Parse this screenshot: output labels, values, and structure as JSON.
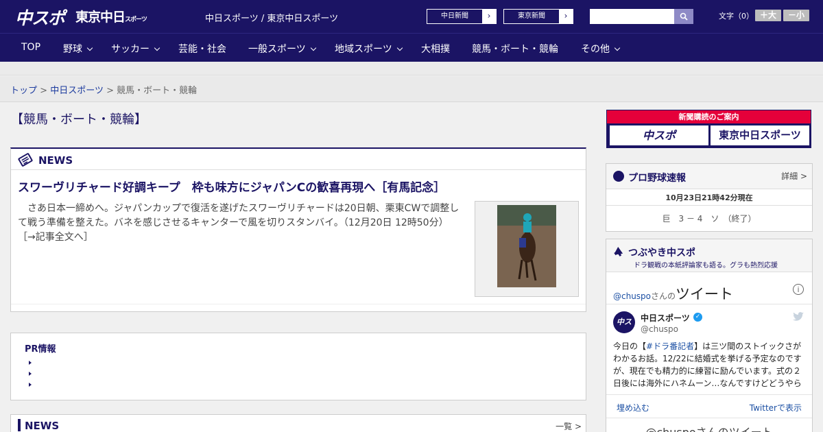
{
  "header": {
    "logo_chuspo": "中スポ",
    "logo_tokyo": "東京中日",
    "logo_tokyo_sub": "スポーツ",
    "site_line": "中日スポーツ / 東京中日スポーツ",
    "paper_links": [
      {
        "label": "中日新聞",
        "arrow": "›"
      },
      {
        "label": "東京新聞",
        "arrow": "›"
      }
    ],
    "search": {
      "placeholder": ""
    },
    "font_size": {
      "label": "文字（0）",
      "plus": "＋大",
      "minus": "－小"
    }
  },
  "nav": [
    {
      "label": "TOP"
    },
    {
      "label": "野球"
    },
    {
      "label": "サッカー"
    },
    {
      "label": "芸能・社会"
    },
    {
      "label": "一般スポーツ"
    },
    {
      "label": "地域スポーツ"
    },
    {
      "label": "大相撲"
    },
    {
      "label": "競馬・ボート・競輪"
    },
    {
      "label": "その他"
    }
  ],
  "breadcrumb": {
    "items": [
      "トップ",
      "中日スポーツ",
      "競馬・ボート・競輪"
    ],
    "separator": ">"
  },
  "page_title": "【競馬・ボート・競輪】",
  "news": {
    "section_title": "NEWS",
    "headline": "スワーヴリチャード好調キープ　枠も味方にジャパンCの歓喜再現へ［有馬記念］",
    "lead": "　さあ日本一締めへ。ジャパンカップで復活を遂げたスワーヴリチャードは20日朝、栗東CWで調整して戦う準備を整えた。バネを感じさせるキャンターで風を切りスタンバイ。（12月20日 12時50分）",
    "more": "［→記事全文へ］"
  },
  "pr": {
    "title": "PR情報"
  },
  "news2": {
    "title": "NEWS",
    "more": "一覧 >"
  },
  "subscribe": {
    "title": "新聞購読のご案内",
    "chuspo": "中スポ",
    "tokyo": "東京中日スポーツ"
  },
  "baseball": {
    "title": "プロ野球速報",
    "detail": "詳細 >",
    "timestamp": "10月23日21時42分現在",
    "game": "巨　3 － 4　ソ　（終了）"
  },
  "twitter_box": {
    "title": "つぶやき中スポ",
    "subtitle": "ドラ観戦の本紙評論家も語る。グラも熱烈応援",
    "handle_prefix": "@chuspo",
    "handle_suffix": "さんの",
    "heading": "ツイート",
    "info": "i",
    "name": "中日スポーツ",
    "handle": "@chuspo",
    "verified": "✓",
    "avatar": "中スポ",
    "tweet_pre": "今日の【",
    "tweet_tag": "#ドラ番記者",
    "tweet_post": "】は三ツ間のストイックさがわかるお話。12/22に結婚式を挙げる予定なのですが、現在でも精力的に練習に励んでいます。式の２日後には海外にハネムーン…なんですけどどうやら",
    "embed": "埋め込む",
    "view_on_twitter": "Twitterで表示",
    "bottom": "@chuspoさんのツイート"
  }
}
